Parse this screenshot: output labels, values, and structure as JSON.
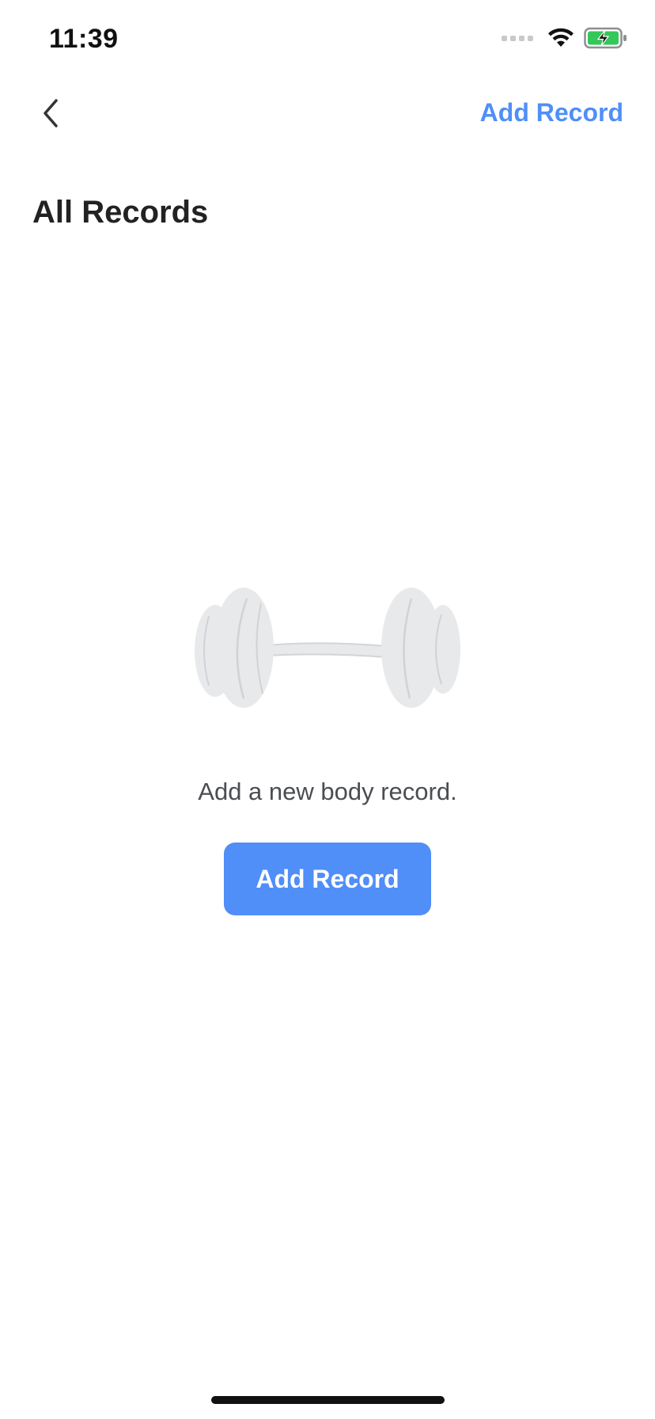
{
  "status_bar": {
    "time": "11:39",
    "icons": [
      "cellular-signal-icon",
      "wifi-icon",
      "battery-charging-icon"
    ]
  },
  "nav": {
    "back_icon": "chevron-left-icon",
    "action_label": "Add Record"
  },
  "page": {
    "title": "All Records"
  },
  "empty_state": {
    "illustration": "dumbbell-icon",
    "message": "Add a new body record.",
    "button_label": "Add Record"
  },
  "colors": {
    "accent": "#508EF8",
    "title_text": "#222222",
    "body_text": "#4A4D52",
    "illustration_fill": "#E8E9EB",
    "battery_green": "#34C759"
  }
}
